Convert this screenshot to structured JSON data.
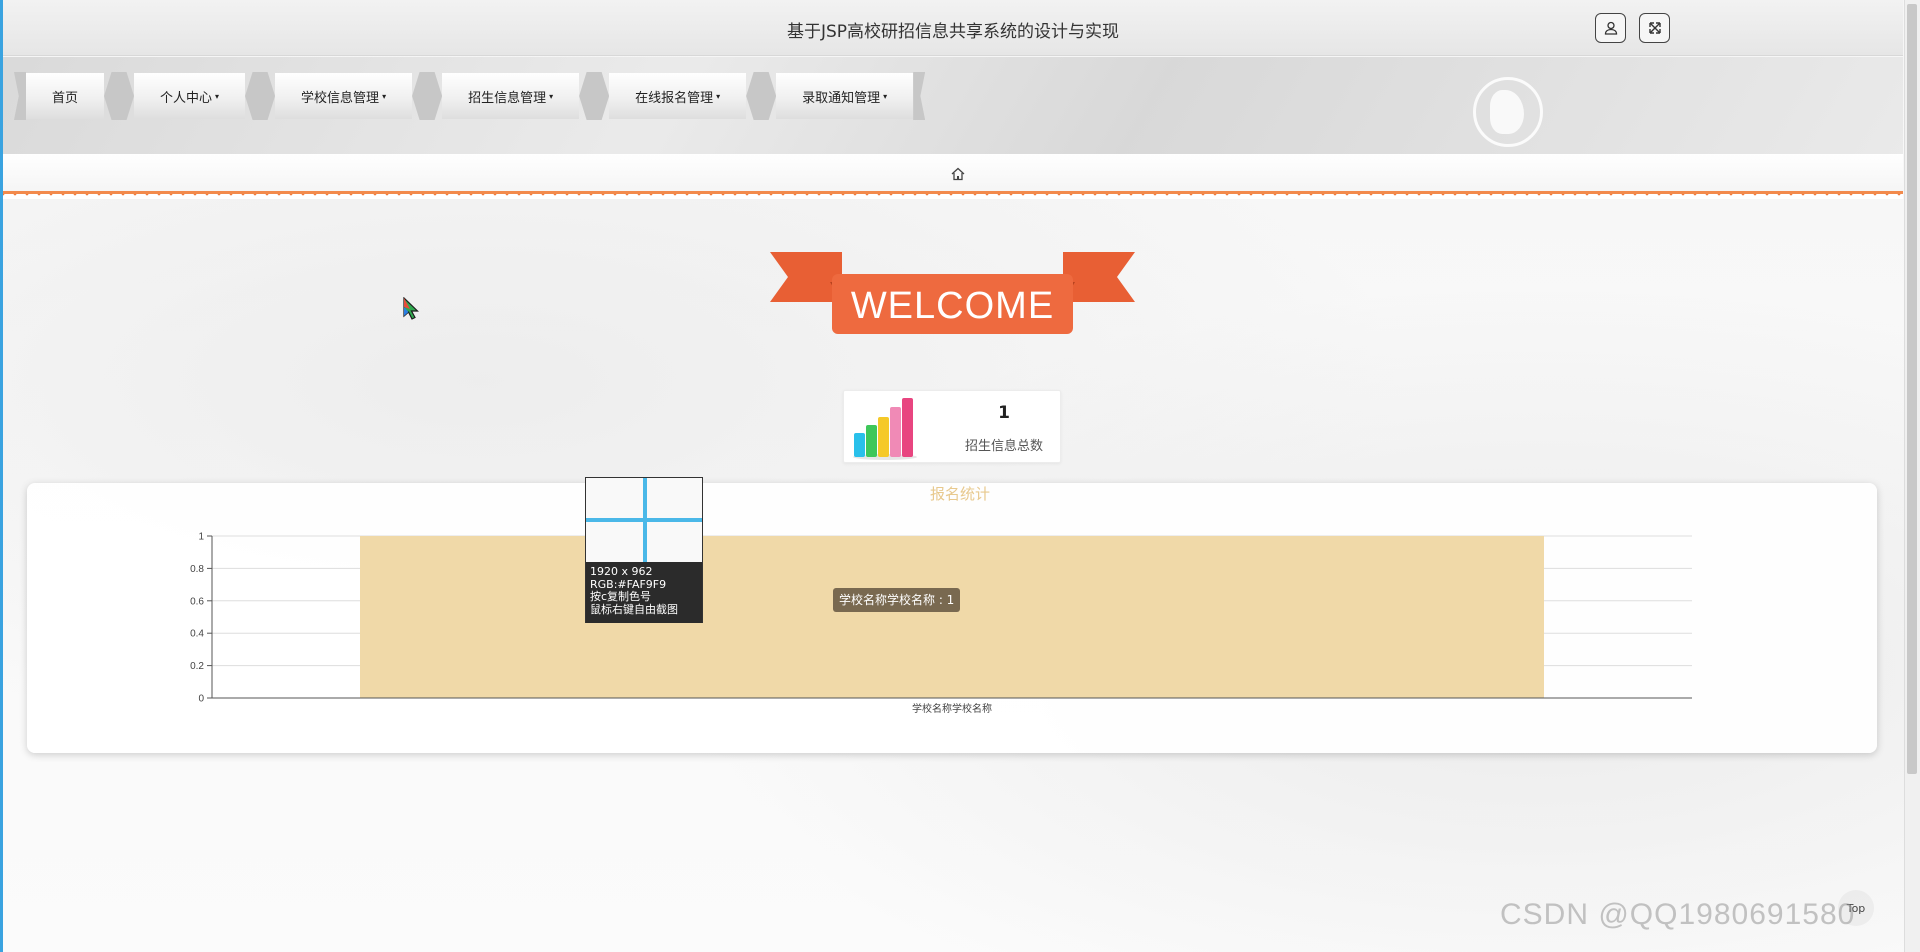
{
  "app": {
    "title": "基于JSP高校研招信息共享系统的设计与实现"
  },
  "topbar": {
    "user_icon": "user-icon",
    "fullscreen_icon": "fullscreen-icon"
  },
  "nav": {
    "items": [
      {
        "label": "首页",
        "dropdown": false
      },
      {
        "label": "个人中心",
        "dropdown": true
      },
      {
        "label": "学校信息管理",
        "dropdown": true
      },
      {
        "label": "招生信息管理",
        "dropdown": true
      },
      {
        "label": "在线报名管理",
        "dropdown": true
      },
      {
        "label": "录取通知管理",
        "dropdown": true
      }
    ],
    "caret": "▾"
  },
  "breadcrumb": {
    "icon": "home-icon"
  },
  "welcome": {
    "text": "WELCOME"
  },
  "stat": {
    "value": "1",
    "label": "招生信息总数"
  },
  "chart_data": {
    "type": "bar",
    "title": "报名统计",
    "categories": [
      "学校名称学校名称"
    ],
    "values": [
      1
    ],
    "ylim": [
      0,
      1
    ],
    "yticks": [
      "0",
      "0.2",
      "0.4",
      "0.6",
      "0.8",
      "1"
    ],
    "grid": true,
    "bar_color": "#f0d9a8",
    "tooltip": "学校名称学校名称 : 1"
  },
  "color_picker": {
    "size": "1920 x 962",
    "rgb": "RGB:#FAF9F9",
    "hint1": "按c复制色号",
    "hint2": "鼠标右键自由截图"
  },
  "footer": {
    "top_label": "Top",
    "watermark": "CSDN @QQ1980691580"
  },
  "colors": {
    "accent_orange": "#f07a3c",
    "banner_orange": "#ee6a3f",
    "bar": "#f0d9a8"
  }
}
